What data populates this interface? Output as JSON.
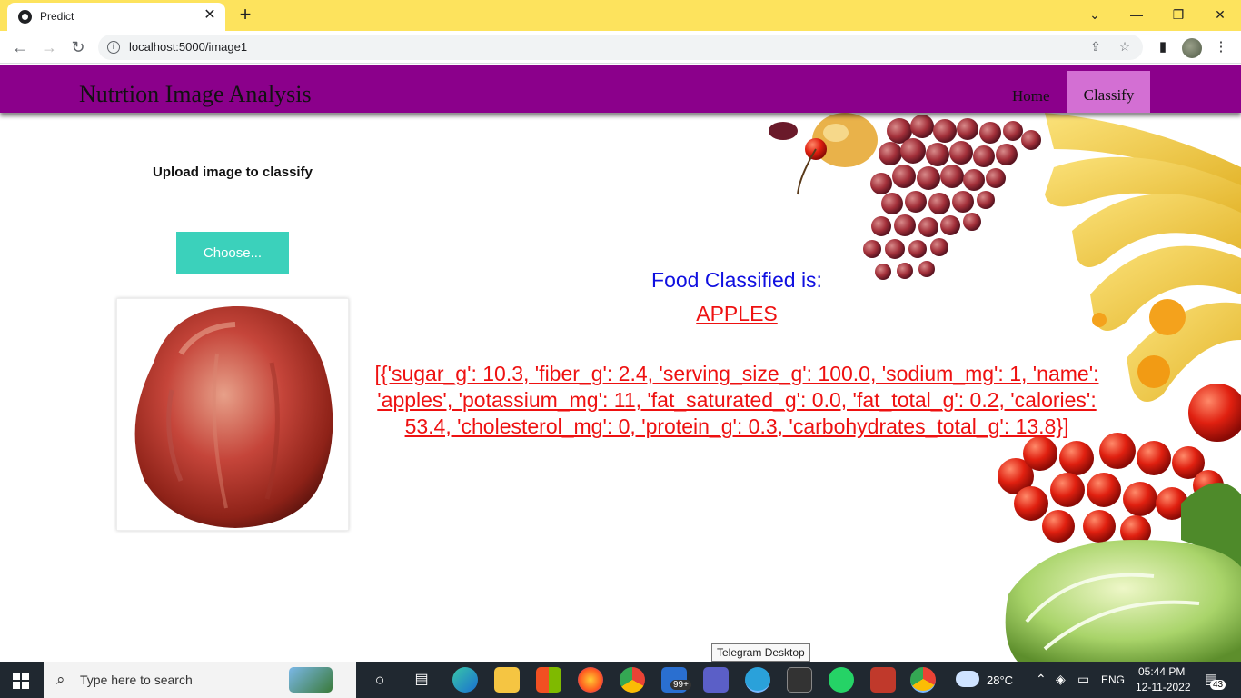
{
  "browser": {
    "tab_title": "Predict",
    "url": "localhost:5000/image1"
  },
  "navbar": {
    "brand": "Nutrtion Image Analysis",
    "items": [
      {
        "label": "Home",
        "active": false
      },
      {
        "label": "Classify",
        "active": true
      }
    ]
  },
  "upload": {
    "label": "Upload image to classify",
    "button": "Choose..."
  },
  "result": {
    "title": "Food Classified is:",
    "food": "APPLES",
    "nutrition": "[{'sugar_g': 10.3, 'fiber_g': 2.4, 'serving_size_g': 100.0, 'sodium_mg': 1, 'name': 'apples', 'potassium_mg': 11, 'fat_saturated_g': 0.0, 'fat_total_g': 0.2, 'calories': 53.4, 'cholesterol_mg': 0, 'protein_g': 0.3, 'carbohydrates_total_g': 13.8}]"
  },
  "tooltip": "Telegram Desktop",
  "taskbar": {
    "search_placeholder": "Type here to search",
    "mail_badge": "99+",
    "weather": "28°C",
    "language": "ENG",
    "time": "05:44 PM",
    "date": "12-11-2022",
    "notifications": "43"
  },
  "colors": {
    "navbar": "#8b008b",
    "nav_active": "#d36fd3",
    "choose_button": "#3bd1bb",
    "result_title": "#1010e0",
    "result_text": "#ee1111",
    "tabbar": "#fde35d"
  }
}
